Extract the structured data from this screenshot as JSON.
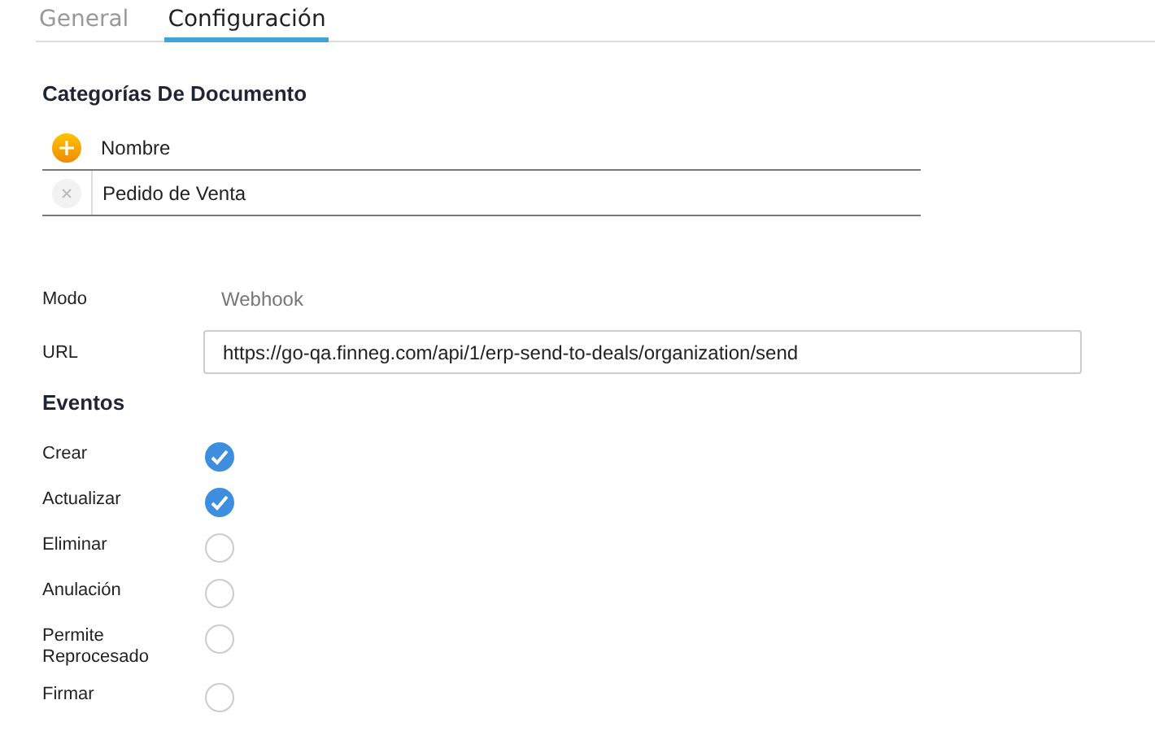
{
  "tabs": [
    {
      "label": "General",
      "selected": false
    },
    {
      "label": "Configuración",
      "selected": true
    }
  ],
  "categories": {
    "title": "Categorías De Documento",
    "header": "Nombre",
    "rows": [
      {
        "name": "Pedido de Venta"
      }
    ]
  },
  "mode": {
    "label": "Modo",
    "value": "Webhook"
  },
  "url": {
    "label": "URL",
    "value": "https://go-qa.finneg.com/api/1/erp-send-to-deals/organization/send"
  },
  "events": {
    "title": "Eventos",
    "items": [
      {
        "label": "Crear",
        "checked": true
      },
      {
        "label": "Actualizar",
        "checked": true
      },
      {
        "label": "Eliminar",
        "checked": false
      },
      {
        "label": "Anulación",
        "checked": false
      },
      {
        "label": "Permite Reprocesado",
        "checked": false
      },
      {
        "label": "Firmar",
        "checked": false
      }
    ]
  }
}
